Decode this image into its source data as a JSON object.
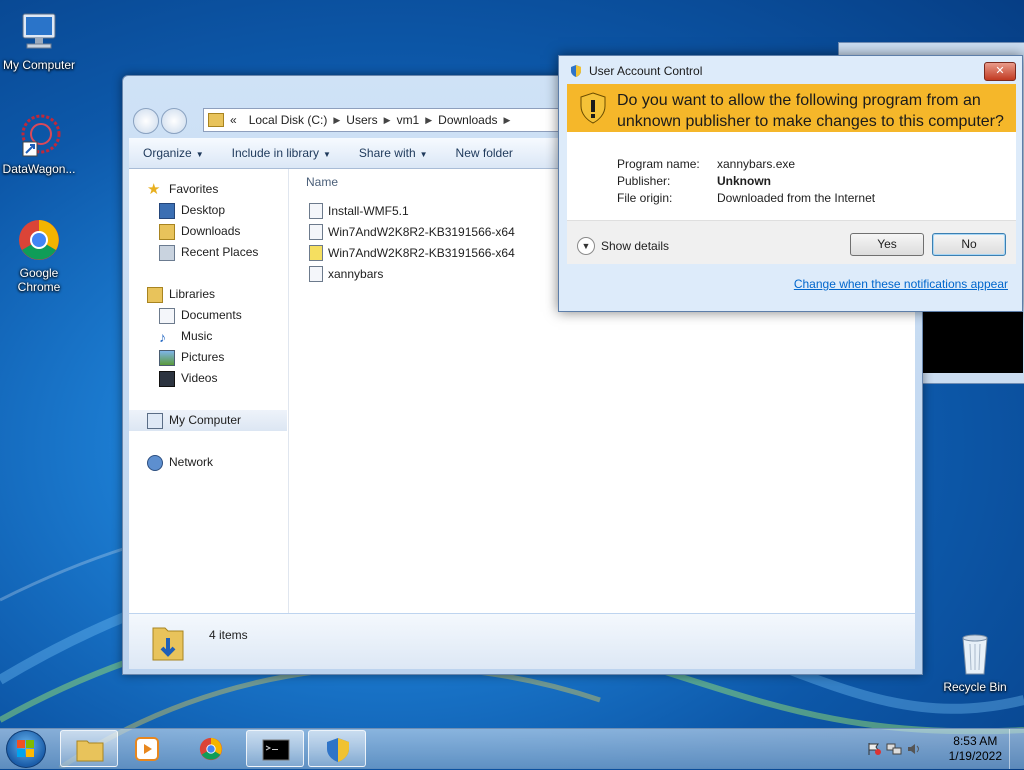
{
  "desktop": {
    "icons": [
      {
        "label": "My Computer"
      },
      {
        "label": "DataWagon..."
      },
      {
        "label": "Google Chrome"
      },
      {
        "label": "Recycle Bin"
      }
    ]
  },
  "explorer": {
    "breadcrumb": [
      "«",
      "Local Disk (C:)",
      "Users",
      "vm1",
      "Downloads"
    ],
    "toolbar": {
      "organize": "Organize",
      "include": "Include in library",
      "share": "Share with",
      "newfolder": "New folder"
    },
    "nav": {
      "favorites": "Favorites",
      "desktop": "Desktop",
      "downloads": "Downloads",
      "recent": "Recent Places",
      "libraries": "Libraries",
      "documents": "Documents",
      "music": "Music",
      "pictures": "Pictures",
      "videos": "Videos",
      "mycomputer": "My Computer",
      "network": "Network"
    },
    "column_name": "Name",
    "files": [
      {
        "name": "Install-WMF5.1"
      },
      {
        "name": "Win7AndW2K8R2-KB3191566-x64"
      },
      {
        "name": "Win7AndW2K8R2-KB3191566-x64"
      },
      {
        "name": "xannybars"
      }
    ],
    "status_count": "4 items"
  },
  "uac": {
    "title": "User Account Control",
    "question_line1": "Do you want to allow the following program from an",
    "question_line2": "unknown publisher to make changes to this computer?",
    "program_label": "Program name:",
    "program_value": "xannybars.exe",
    "publisher_label": "Publisher:",
    "publisher_value": "Unknown",
    "origin_label": "File origin:",
    "origin_value": "Downloaded from the Internet",
    "show_details": "Show details",
    "yes": "Yes",
    "no": "No",
    "link": "Change when these notifications appear",
    "banner_color": "#f5b72a"
  },
  "taskbar": {
    "time": "8:53 AM",
    "date": "1/19/2022"
  }
}
